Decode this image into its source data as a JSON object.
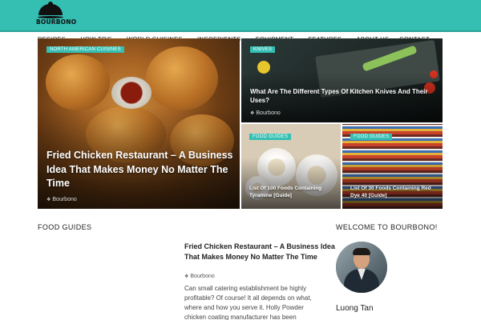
{
  "brand": {
    "logo_text": "BOURBONO",
    "accent": "#35bfb3"
  },
  "nav": {
    "items": [
      {
        "label": "Recipes",
        "has_dropdown": true
      },
      {
        "label": "How To's",
        "has_dropdown": true
      },
      {
        "label": "World Cuisines",
        "has_dropdown": true
      },
      {
        "label": "Ingredients",
        "has_dropdown": true
      },
      {
        "label": "Equipment",
        "has_dropdown": true
      },
      {
        "label": "Features",
        "has_dropdown": true
      },
      {
        "label": "About Us",
        "has_dropdown": false
      },
      {
        "label": "Contact",
        "has_dropdown": false
      }
    ],
    "dropdown_icon": "chevron-down-icon"
  },
  "hero": {
    "main": {
      "category": "North American Cuisines",
      "title": "Fried Chicken Restaurant – A Business Idea That Makes Money No Matter The Time",
      "author": "Bourbono"
    },
    "knives": {
      "category": "Knives",
      "title": "What Are The Different Types Of Kitchen Knives And Their Uses?",
      "author": "Bourbono"
    },
    "tyramine": {
      "category": "Food Guides",
      "title": "List Of 100 Foods Containing Tyramine [Guide]"
    },
    "dye": {
      "category": "Food Guides",
      "title": "List Of 30 Foods Containing Red Dye 40 [Guide]"
    }
  },
  "food_guides": {
    "heading": "Food Guides",
    "article": {
      "title": "Fried Chicken Restaurant – A Business Idea That Makes Money No Matter The Time",
      "author": "Bourbono",
      "excerpt": "Can small catering establishment be highly profitable? Of course! It all depends on what, where and how you serve it. Holly Powder chicken coating manufacturer has been"
    }
  },
  "sidebar": {
    "heading": "Welcome To Bourbono!",
    "author_name": "Luong Tan"
  }
}
